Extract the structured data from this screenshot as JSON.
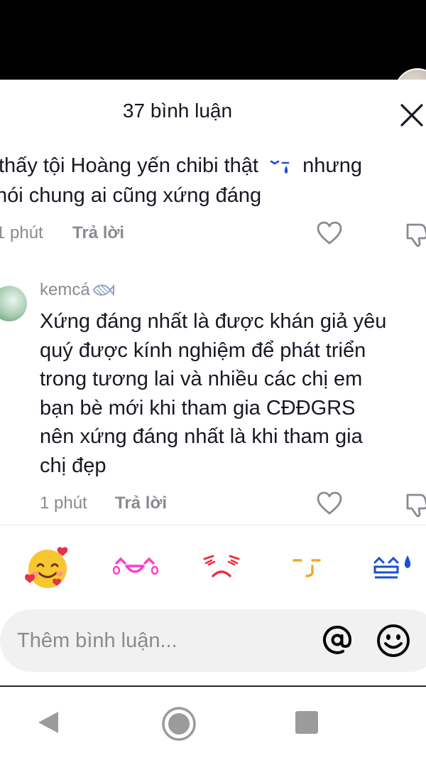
{
  "header": {
    "title": "37 bình luận"
  },
  "comments": [
    {
      "lines": [
        "thấy tội Hoàng yến chibi thật",
        "nhưng",
        "nói chung ai cũng xứng đáng"
      ],
      "time": "1 phút",
      "reply_label": "Trả lời"
    },
    {
      "username": "kemcá",
      "lines": [
        "Xứng đáng nhất là được khán giả yêu",
        "quý được kính nghiệm để phát triển",
        "trong tương lai và nhiều các chị em",
        "bạn bè mới khi tham gia CĐĐGRS",
        "nên xứng đáng nhất là khi tham gia",
        "chị đẹp"
      ],
      "time": "1 phút",
      "reply_label": "Trả lời"
    }
  ],
  "emoji_bar": [
    "smiling-face-with-hearts",
    "tiktok-joyful-emoji",
    "tiktok-angry-emoji",
    "tiktok-smirk-emoji",
    "tiktok-sweat-emoji"
  ],
  "comment_input": {
    "placeholder": "Thêm bình luận..."
  },
  "colors": {
    "text": "#161823",
    "muted": "#8a8b91",
    "input_bg": "#f1f1f2",
    "pink": "#ff3ccf",
    "red": "#ee2f3a",
    "orange": "#f5a623",
    "blue": "#1a4fd6"
  }
}
